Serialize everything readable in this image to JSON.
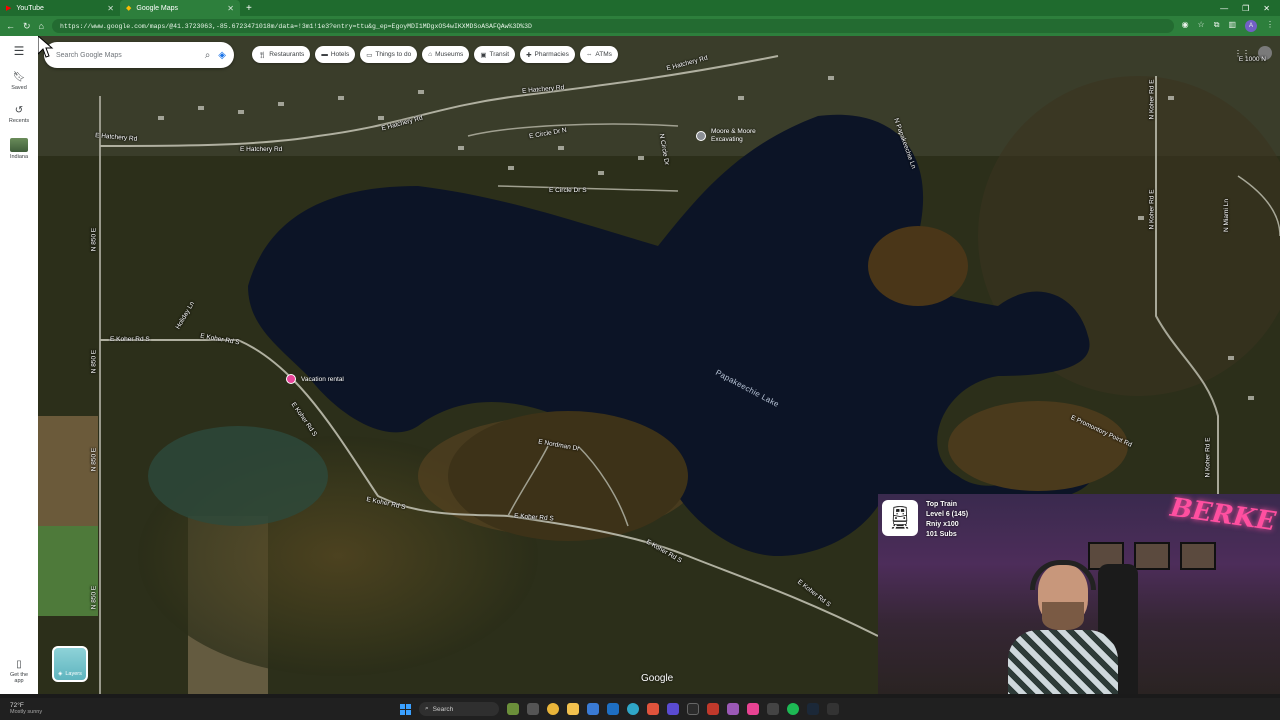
{
  "browser": {
    "tabs": [
      {
        "title": "YouTube",
        "icon": "youtube-icon",
        "color": "#ff0000"
      },
      {
        "title": "Google Maps",
        "icon": "maps-icon",
        "color": "#34a853"
      }
    ],
    "url": "https://www.google.com/maps/@41.3723063,-85.6723471018m/data=!3m1!1e3?entry=ttu&g_ep=EgoyMDI1MDgxOS4wIKXMDSoASAFQAw%3D%3D"
  },
  "rail": {
    "menu_icon": "hamburger-icon",
    "items": [
      {
        "label": "Saved",
        "icon": "bookmark-icon"
      },
      {
        "label": "Recents",
        "icon": "history-icon"
      },
      {
        "label": "Indiana",
        "icon": "thumbnail"
      }
    ],
    "get_app": "Get the app"
  },
  "search": {
    "placeholder": "Search Google Maps"
  },
  "chips": [
    {
      "label": "Restaurants",
      "icon": "fork-knife-icon"
    },
    {
      "label": "Hotels",
      "icon": "bed-icon"
    },
    {
      "label": "Things to do",
      "icon": "ticket-icon"
    },
    {
      "label": "Museums",
      "icon": "museum-icon"
    },
    {
      "label": "Transit",
      "icon": "train-icon"
    },
    {
      "label": "Pharmacies",
      "icon": "pill-icon"
    },
    {
      "label": "ATMs",
      "icon": "atm-icon"
    }
  ],
  "map": {
    "lake_label": "Papakeechie Lake",
    "roads": [
      "E Hatchery Rd",
      "E Hatchery Rd",
      "E Hatchery Rd",
      "E Hatchery Rd",
      "E Hatchery Rd",
      "E Circle Dr N",
      "E Circle Dr S",
      "N Circle Dr",
      "E Koher Rd S",
      "E Koher Rd S",
      "E Koher Rd S",
      "E Koher Rd S",
      "E Koher Rd S",
      "E Koher Rd S",
      "E Koher Rd S",
      "E Nordman Dr",
      "E Promontory Point Rd",
      "N 850 E",
      "N 850 E",
      "N 850 E",
      "N 850 E",
      "N Koher Rd E",
      "N Koher Rd E",
      "N Koher Rd E",
      "Holiday Ln",
      "N Papakeechie Ln",
      "N Miami Ln",
      "E 1000 N"
    ],
    "pois": [
      {
        "name": "Moore & Moore Excavating",
        "line1": "Moore & Moore",
        "line2": "Excavating"
      },
      {
        "name": "Vacation rental"
      }
    ],
    "layers_label": "Layers",
    "google_label": "Google"
  },
  "overlay": {
    "title": "Top Train",
    "line2": "Level 6  (145)",
    "line3": "Rniy x100",
    "line4": "101 Subs",
    "neon": "BERKE"
  },
  "taskbar": {
    "temp": "72°F",
    "weather": "Mostly sunny",
    "search": "Search"
  }
}
